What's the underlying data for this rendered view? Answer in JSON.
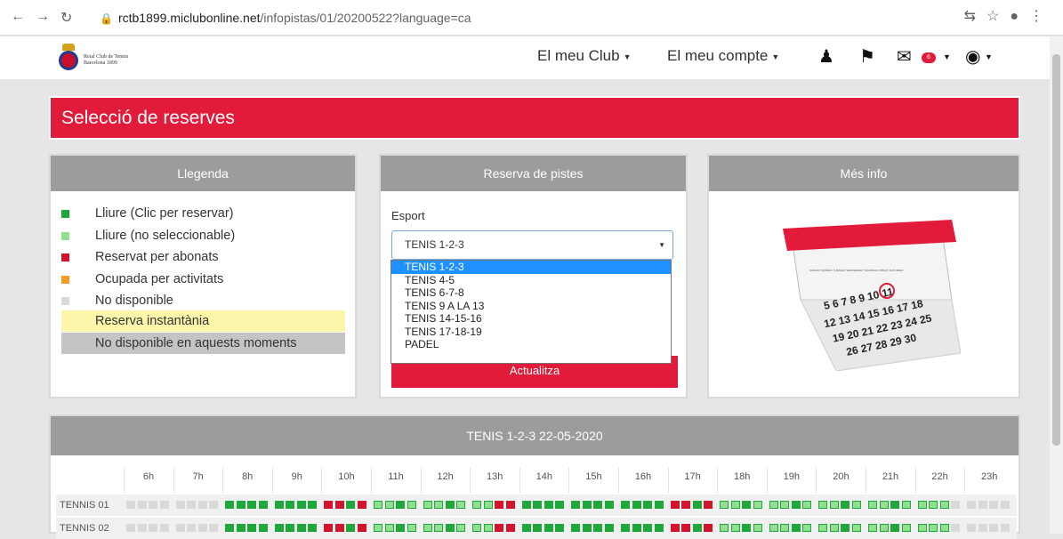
{
  "browser": {
    "url_host": "rctb1899.miclubonline.net",
    "url_path": "/infopistas/01/20200522?language=ca"
  },
  "header": {
    "logo_line1": "Reial Club de Tennis",
    "logo_line2": "Barcelona 1899",
    "nav_club": "El meu Club",
    "nav_account": "El meu compte",
    "mail_count": "6"
  },
  "page": {
    "title": "Selecció de reserves"
  },
  "legend": {
    "title": "Llegenda",
    "items": [
      {
        "label": "Lliure (Clic per reservar)",
        "color": "#1fa83a"
      },
      {
        "label": "Lliure (no seleccionable)",
        "color": "#8fe08f"
      },
      {
        "label": "Reservat per abonats",
        "color": "#d0152c"
      },
      {
        "label": "Ocupada per activitats",
        "color": "#f59a23"
      },
      {
        "label": "No disponible",
        "color": "#d9d9d9"
      }
    ],
    "instant": "Reserva instantània",
    "instant_color": "#fbf6a9",
    "unavailable_now": "No disponible en aquests moments",
    "unavailable_now_color": "#c4c4c4"
  },
  "booking": {
    "title": "Reserva de pistes",
    "sport_label": "Esport",
    "selected": "TENIS 1-2-3",
    "options": [
      "TENIS 1-2-3",
      "TENIS 4-5",
      "TENIS 6-7-8",
      "TENIS 9 A LA 13",
      "TENIS 14-15-16",
      "TENIS 17-18-19",
      "PADEL"
    ],
    "update_label": "Actualitza"
  },
  "info": {
    "title": "Més info"
  },
  "schedule": {
    "title": "TENIS 1-2-3 22-05-2020",
    "hours": [
      "6h",
      "7h",
      "8h",
      "9h",
      "10h",
      "11h",
      "12h",
      "13h",
      "14h",
      "15h",
      "16h",
      "17h",
      "18h",
      "19h",
      "20h",
      "21h",
      "22h",
      "23h"
    ],
    "courts": [
      {
        "name": "TENNIS 01",
        "slots": [
          "nnnn",
          "nnnn",
          "ffff",
          "ffff",
          "rrfr",
          "llfl",
          "llfl",
          "llrr",
          "ffff",
          "ffff",
          "ffff",
          "rrfr",
          "llfl",
          "llfl",
          "llfl",
          "llfl",
          "llln",
          "nnnn"
        ]
      },
      {
        "name": "TENNIS 02",
        "slots": [
          "nnnn",
          "nnnn",
          "ffff",
          "ffff",
          "rrfr",
          "llfl",
          "llfl",
          "llrr",
          "ffff",
          "ffff",
          "ffff",
          "rrfr",
          "llfl",
          "llfl",
          "llfl",
          "llfl",
          "llln",
          "nnnn"
        ]
      }
    ]
  },
  "colors": {
    "accent": "#e31b3b",
    "panel_header": "#9c9c9c",
    "free": "#1fa83a",
    "free_noselect": "#8fe08f",
    "reserved": "#d0152c",
    "unavailable": "#d9d9d9"
  }
}
